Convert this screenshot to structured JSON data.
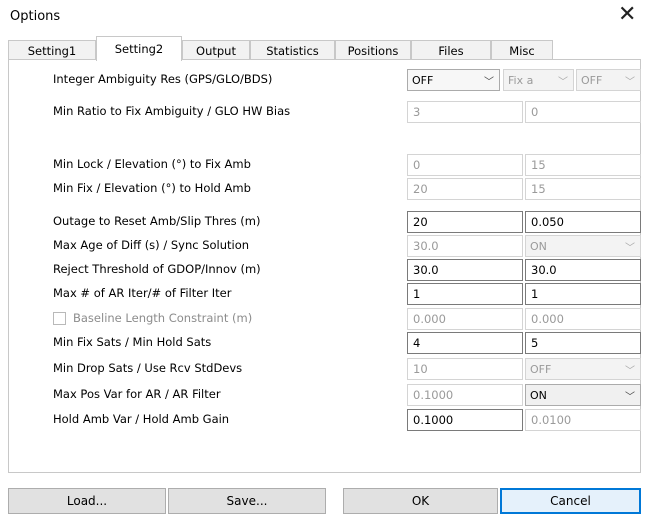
{
  "window": {
    "title": "Options",
    "close_glyph": "✕"
  },
  "tabs": [
    {
      "label": "Setting1",
      "active": false
    },
    {
      "label": "Setting2",
      "active": true
    },
    {
      "label": "Output",
      "active": false
    },
    {
      "label": "Statistics",
      "active": false
    },
    {
      "label": "Positions",
      "active": false
    },
    {
      "label": "Files",
      "active": false
    },
    {
      "label": "Misc",
      "active": false
    }
  ],
  "rows": [
    {
      "label": "Integer Ambiguity Res (GPS/GLO/BDS)",
      "c1": "OFF",
      "c2": "Fix a",
      "c3": "OFF"
    },
    {
      "label": "Min Ratio to Fix Ambiguity / GLO HW Bias",
      "f1": "3",
      "f2": "0"
    },
    {
      "label": "Min Lock / Elevation (°) to Fix Amb",
      "f1": "0",
      "f2": "15"
    },
    {
      "label": "Min Fix / Elevation (°) to Hold Amb",
      "f1": "20",
      "f2": "15"
    },
    {
      "label": "Outage to Reset Amb/Slip Thres (m)",
      "f1": "20",
      "f2": "0.050"
    },
    {
      "label": "Max Age of Diff (s) / Sync Solution",
      "f1": "30.0",
      "c2": "ON"
    },
    {
      "label": "Reject Threshold of GDOP/Innov (m)",
      "f1": "30.0",
      "f2": "30.0"
    },
    {
      "label": "Max # of AR Iter/# of Filter Iter",
      "f1": "1",
      "f2": "1"
    },
    {
      "label": "Baseline Length Constraint (m)",
      "f1": "0.000",
      "f2": "0.000"
    },
    {
      "label": "Min Fix Sats / Min Hold Sats",
      "f1": "4",
      "f2": "5"
    },
    {
      "label": "Min Drop Sats / Use Rcv StdDevs",
      "f1": "10",
      "c2": "OFF"
    },
    {
      "label": "Max Pos Var for AR / AR Filter",
      "f1": "0.1000",
      "c2": "ON"
    },
    {
      "label": "Hold Amb Var / Hold Amb Gain",
      "f1": "0.1000",
      "f2": "0.0100"
    }
  ],
  "buttons": {
    "load": "Load...",
    "save": "Save...",
    "ok": "OK",
    "cancel": "Cancel"
  },
  "icons": {
    "chevron": "chevron-down-icon",
    "close": "close-icon"
  },
  "colors": {
    "focus_border": "#0078d7",
    "disabled_text": "#9a9a9a"
  }
}
